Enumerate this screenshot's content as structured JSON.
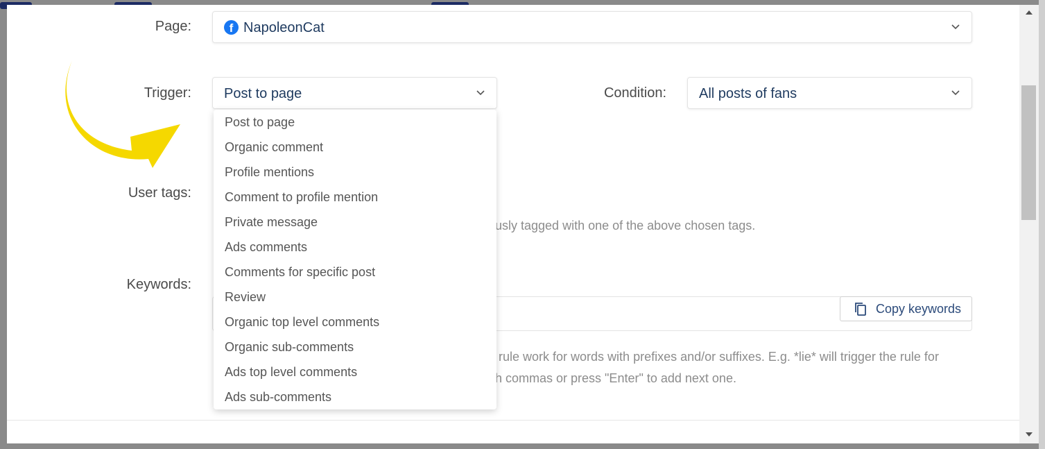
{
  "form": {
    "page": {
      "label": "Page:",
      "value": "NapoleonCat",
      "icon": "facebook-icon"
    },
    "trigger": {
      "label": "Trigger:",
      "value": "Post to page",
      "options": [
        "Post to page",
        "Organic comment",
        "Profile mentions",
        "Comment to profile mention",
        "Private message",
        "Ads comments",
        "Comments for specific post",
        "Review",
        "Organic top level comments",
        "Organic sub-comments",
        "Ads top level comments",
        "Ads sub-comments"
      ]
    },
    "condition": {
      "label": "Condition:",
      "value": "All posts of fans"
    },
    "user_tags": {
      "label": "User tags:",
      "helper_partial": "usly tagged with one of the above chosen tags."
    },
    "keywords": {
      "label": "Keywords:",
      "copy_label": "Copy keywords",
      "helper_line1_partial": "e rule work for words with prefixes and/or suffixes. E.g. *lie* will trigger the rule for",
      "helper_line2_partial": "h commas or press \"Enter\" to add next one."
    }
  },
  "colors": {
    "accent_arrow": "#f5d800",
    "facebook": "#1877f2",
    "value_text": "#1e3a5f"
  }
}
